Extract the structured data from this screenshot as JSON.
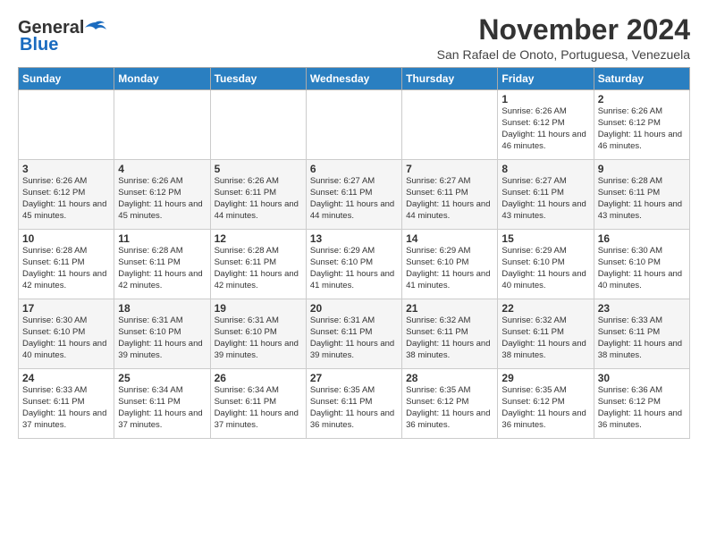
{
  "logo": {
    "part1": "General",
    "part2": "Blue"
  },
  "header": {
    "month_title": "November 2024",
    "location": "San Rafael de Onoto, Portuguesa, Venezuela"
  },
  "weekdays": [
    "Sunday",
    "Monday",
    "Tuesday",
    "Wednesday",
    "Thursday",
    "Friday",
    "Saturday"
  ],
  "weeks": [
    [
      {
        "day": "",
        "sunrise": "",
        "sunset": "",
        "daylight": ""
      },
      {
        "day": "",
        "sunrise": "",
        "sunset": "",
        "daylight": ""
      },
      {
        "day": "",
        "sunrise": "",
        "sunset": "",
        "daylight": ""
      },
      {
        "day": "",
        "sunrise": "",
        "sunset": "",
        "daylight": ""
      },
      {
        "day": "",
        "sunrise": "",
        "sunset": "",
        "daylight": ""
      },
      {
        "day": "1",
        "sunrise": "Sunrise: 6:26 AM",
        "sunset": "Sunset: 6:12 PM",
        "daylight": "Daylight: 11 hours and 46 minutes."
      },
      {
        "day": "2",
        "sunrise": "Sunrise: 6:26 AM",
        "sunset": "Sunset: 6:12 PM",
        "daylight": "Daylight: 11 hours and 46 minutes."
      }
    ],
    [
      {
        "day": "3",
        "sunrise": "Sunrise: 6:26 AM",
        "sunset": "Sunset: 6:12 PM",
        "daylight": "Daylight: 11 hours and 45 minutes."
      },
      {
        "day": "4",
        "sunrise": "Sunrise: 6:26 AM",
        "sunset": "Sunset: 6:12 PM",
        "daylight": "Daylight: 11 hours and 45 minutes."
      },
      {
        "day": "5",
        "sunrise": "Sunrise: 6:26 AM",
        "sunset": "Sunset: 6:11 PM",
        "daylight": "Daylight: 11 hours and 44 minutes."
      },
      {
        "day": "6",
        "sunrise": "Sunrise: 6:27 AM",
        "sunset": "Sunset: 6:11 PM",
        "daylight": "Daylight: 11 hours and 44 minutes."
      },
      {
        "day": "7",
        "sunrise": "Sunrise: 6:27 AM",
        "sunset": "Sunset: 6:11 PM",
        "daylight": "Daylight: 11 hours and 44 minutes."
      },
      {
        "day": "8",
        "sunrise": "Sunrise: 6:27 AM",
        "sunset": "Sunset: 6:11 PM",
        "daylight": "Daylight: 11 hours and 43 minutes."
      },
      {
        "day": "9",
        "sunrise": "Sunrise: 6:28 AM",
        "sunset": "Sunset: 6:11 PM",
        "daylight": "Daylight: 11 hours and 43 minutes."
      }
    ],
    [
      {
        "day": "10",
        "sunrise": "Sunrise: 6:28 AM",
        "sunset": "Sunset: 6:11 PM",
        "daylight": "Daylight: 11 hours and 42 minutes."
      },
      {
        "day": "11",
        "sunrise": "Sunrise: 6:28 AM",
        "sunset": "Sunset: 6:11 PM",
        "daylight": "Daylight: 11 hours and 42 minutes."
      },
      {
        "day": "12",
        "sunrise": "Sunrise: 6:28 AM",
        "sunset": "Sunset: 6:11 PM",
        "daylight": "Daylight: 11 hours and 42 minutes."
      },
      {
        "day": "13",
        "sunrise": "Sunrise: 6:29 AM",
        "sunset": "Sunset: 6:10 PM",
        "daylight": "Daylight: 11 hours and 41 minutes."
      },
      {
        "day": "14",
        "sunrise": "Sunrise: 6:29 AM",
        "sunset": "Sunset: 6:10 PM",
        "daylight": "Daylight: 11 hours and 41 minutes."
      },
      {
        "day": "15",
        "sunrise": "Sunrise: 6:29 AM",
        "sunset": "Sunset: 6:10 PM",
        "daylight": "Daylight: 11 hours and 40 minutes."
      },
      {
        "day": "16",
        "sunrise": "Sunrise: 6:30 AM",
        "sunset": "Sunset: 6:10 PM",
        "daylight": "Daylight: 11 hours and 40 minutes."
      }
    ],
    [
      {
        "day": "17",
        "sunrise": "Sunrise: 6:30 AM",
        "sunset": "Sunset: 6:10 PM",
        "daylight": "Daylight: 11 hours and 40 minutes."
      },
      {
        "day": "18",
        "sunrise": "Sunrise: 6:31 AM",
        "sunset": "Sunset: 6:10 PM",
        "daylight": "Daylight: 11 hours and 39 minutes."
      },
      {
        "day": "19",
        "sunrise": "Sunrise: 6:31 AM",
        "sunset": "Sunset: 6:10 PM",
        "daylight": "Daylight: 11 hours and 39 minutes."
      },
      {
        "day": "20",
        "sunrise": "Sunrise: 6:31 AM",
        "sunset": "Sunset: 6:11 PM",
        "daylight": "Daylight: 11 hours and 39 minutes."
      },
      {
        "day": "21",
        "sunrise": "Sunrise: 6:32 AM",
        "sunset": "Sunset: 6:11 PM",
        "daylight": "Daylight: 11 hours and 38 minutes."
      },
      {
        "day": "22",
        "sunrise": "Sunrise: 6:32 AM",
        "sunset": "Sunset: 6:11 PM",
        "daylight": "Daylight: 11 hours and 38 minutes."
      },
      {
        "day": "23",
        "sunrise": "Sunrise: 6:33 AM",
        "sunset": "Sunset: 6:11 PM",
        "daylight": "Daylight: 11 hours and 38 minutes."
      }
    ],
    [
      {
        "day": "24",
        "sunrise": "Sunrise: 6:33 AM",
        "sunset": "Sunset: 6:11 PM",
        "daylight": "Daylight: 11 hours and 37 minutes."
      },
      {
        "day": "25",
        "sunrise": "Sunrise: 6:34 AM",
        "sunset": "Sunset: 6:11 PM",
        "daylight": "Daylight: 11 hours and 37 minutes."
      },
      {
        "day": "26",
        "sunrise": "Sunrise: 6:34 AM",
        "sunset": "Sunset: 6:11 PM",
        "daylight": "Daylight: 11 hours and 37 minutes."
      },
      {
        "day": "27",
        "sunrise": "Sunrise: 6:35 AM",
        "sunset": "Sunset: 6:11 PM",
        "daylight": "Daylight: 11 hours and 36 minutes."
      },
      {
        "day": "28",
        "sunrise": "Sunrise: 6:35 AM",
        "sunset": "Sunset: 6:12 PM",
        "daylight": "Daylight: 11 hours and 36 minutes."
      },
      {
        "day": "29",
        "sunrise": "Sunrise: 6:35 AM",
        "sunset": "Sunset: 6:12 PM",
        "daylight": "Daylight: 11 hours and 36 minutes."
      },
      {
        "day": "30",
        "sunrise": "Sunrise: 6:36 AM",
        "sunset": "Sunset: 6:12 PM",
        "daylight": "Daylight: 11 hours and 36 minutes."
      }
    ]
  ]
}
